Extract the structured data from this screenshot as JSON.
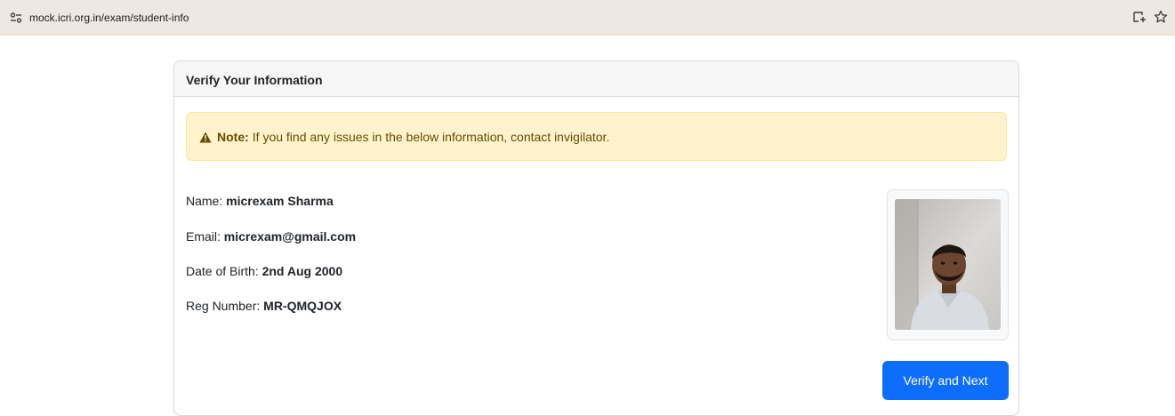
{
  "browser": {
    "url": "mock.icri.org.in/exam/student-info",
    "site_icon": "tune-icon",
    "right_icons": [
      "screenshot-icon",
      "star-icon"
    ]
  },
  "card": {
    "title": "Verify Your Information"
  },
  "alert": {
    "icon": "warning-icon",
    "label": "Note:",
    "message": "If you find any issues in the below information, contact invigilator."
  },
  "student": {
    "name_label": "Name:",
    "name": "micrexam Sharma",
    "email_label": "Email:",
    "email": "micrexam@gmail.com",
    "dob_label": "Date of Birth:",
    "dob": "2nd Aug 2000",
    "reg_label": "Reg Number:",
    "reg": "MR-QMQJOX"
  },
  "actions": {
    "verify_label": "Verify and Next"
  },
  "colors": {
    "primary": "#0d6efd",
    "alert_bg": "#fff3cd",
    "alert_text": "#664d03"
  }
}
